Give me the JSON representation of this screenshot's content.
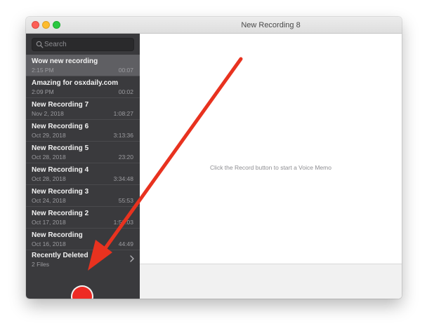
{
  "window": {
    "title": "New Recording 8"
  },
  "sidebar": {
    "search": {
      "placeholder": "Search",
      "value": ""
    },
    "recordings": [
      {
        "name": "Wow new recording",
        "date": "2:15 PM",
        "duration": "00:07",
        "selected": true
      },
      {
        "name": "Amazing for osxdaily.com",
        "date": "2:09 PM",
        "duration": "00:02"
      },
      {
        "name": "New Recording 7",
        "date": "Nov 2, 2018",
        "duration": "1:08:27"
      },
      {
        "name": "New Recording 6",
        "date": "Oct 29, 2018",
        "duration": "3:13:36"
      },
      {
        "name": "New Recording 5",
        "date": "Oct 28, 2018",
        "duration": "23:20"
      },
      {
        "name": "New Recording 4",
        "date": "Oct 28, 2018",
        "duration": "3:34:48"
      },
      {
        "name": "New Recording 3",
        "date": "Oct 24, 2018",
        "duration": "55:53"
      },
      {
        "name": "New Recording 2",
        "date": "Oct 17, 2018",
        "duration": "1:50:03"
      },
      {
        "name": "New Recording",
        "date": "Oct 16, 2018",
        "duration": "44:49"
      }
    ],
    "recently_deleted": {
      "label": "Recently Deleted",
      "count": "2 Files"
    }
  },
  "main": {
    "hint": "Click the Record button to start a Voice Memo"
  },
  "colors": {
    "record_button": "#ee2a24",
    "annotation_arrow": "#e8321f",
    "sidebar_bg": "#3a3a3d",
    "selected_row": "#5f5f63"
  },
  "icons": {
    "search": "search-icon",
    "chevron": "chevron-right-icon",
    "record": "record-icon"
  }
}
